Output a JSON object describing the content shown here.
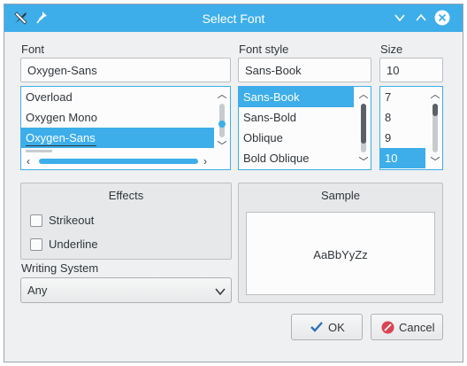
{
  "window": {
    "title": "Select Font"
  },
  "labels": {
    "font": "Font",
    "font_style": "Font style",
    "size": "Size"
  },
  "inputs": {
    "font": "Oxygen-Sans",
    "style": "Sans-Book",
    "size": "10"
  },
  "font_list": [
    "Overload",
    "Oxygen Mono",
    "Oxygen-Sans"
  ],
  "style_list": [
    "Sans-Book",
    "Sans-Bold",
    "Oblique",
    "Bold Oblique"
  ],
  "size_list": [
    "7",
    "8",
    "9",
    "10"
  ],
  "effects": {
    "title": "Effects",
    "strikeout": "Strikeout",
    "underline": "Underline"
  },
  "writing_system": {
    "label": "Writing System",
    "value": "Any"
  },
  "sample": {
    "title": "Sample",
    "text": "AaBbYyZz"
  },
  "buttons": {
    "ok": "OK",
    "cancel": "Cancel"
  },
  "colors": {
    "accent": "#3daee9",
    "window_bg": "#eff0f1"
  }
}
